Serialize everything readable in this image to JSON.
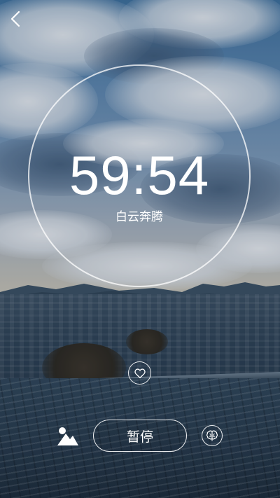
{
  "timer": {
    "time": "59:54",
    "label": "白云奔腾"
  },
  "controls": {
    "pause_label": "暂停"
  },
  "icons": {
    "back": "back-arrow-icon",
    "favorite": "heart-icon",
    "scene": "image-landscape-icon",
    "mind": "brain-icon"
  },
  "colors": {
    "foreground": "#ffffff"
  }
}
